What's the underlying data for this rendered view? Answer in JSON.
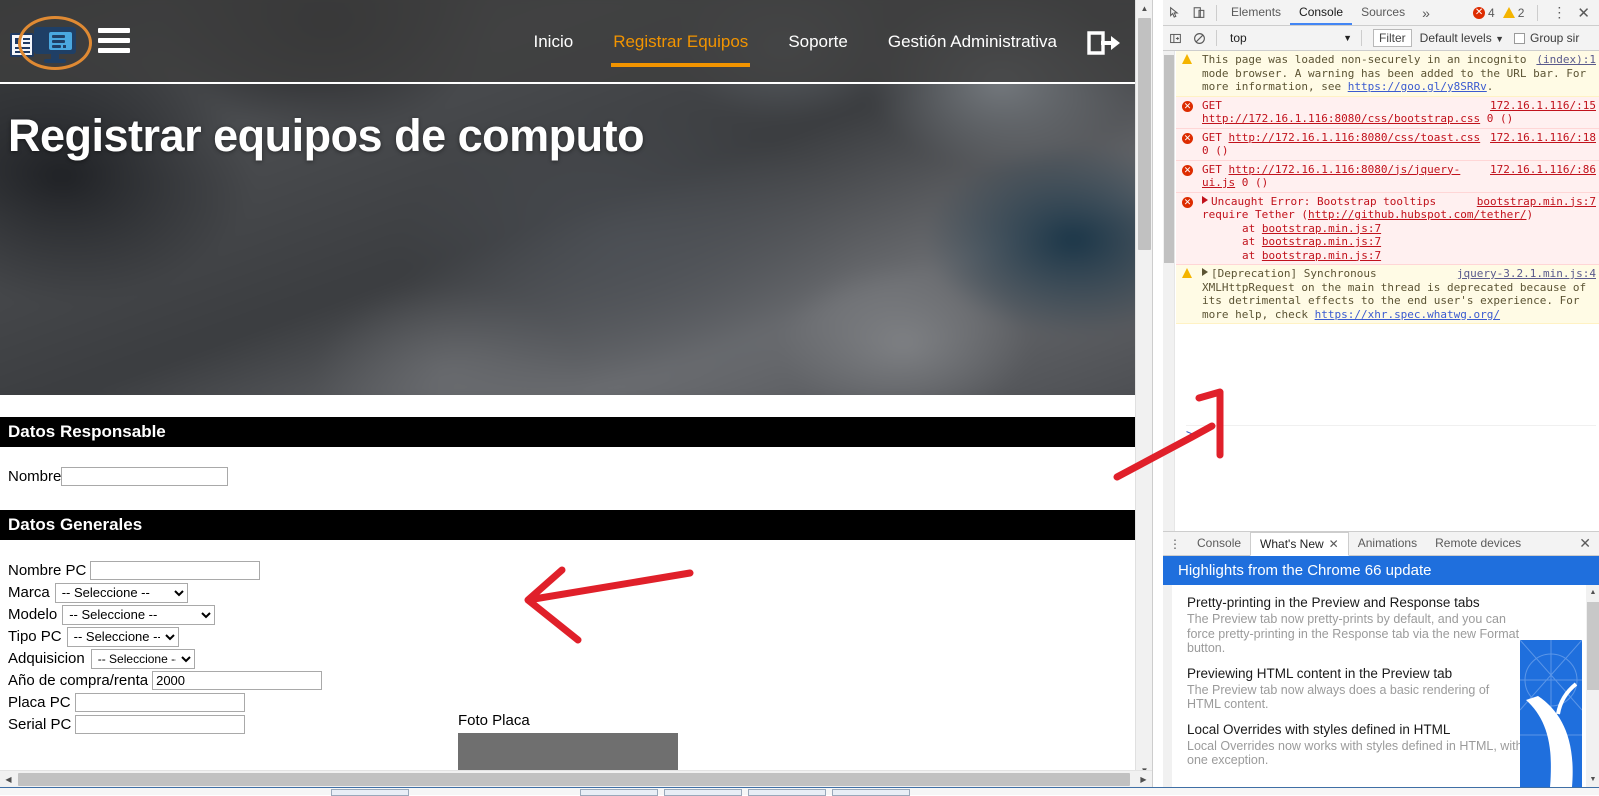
{
  "site": {
    "logo_icon": "monitor-server-logo-icon",
    "menu_icon": "hamburger-menu-icon",
    "logout_icon": "logout-icon",
    "nav": [
      {
        "label": "Inicio",
        "active": false
      },
      {
        "label": "Registrar Equipos",
        "active": true
      },
      {
        "label": "Soporte",
        "active": false
      },
      {
        "label": "Gestión Administrativa",
        "active": false
      }
    ],
    "accent_color": "#f29400",
    "hero_title": "Registrar equipos de computo"
  },
  "form": {
    "section_responsable": "Datos Responsable",
    "section_generales": "Datos Generales",
    "nombre": {
      "label": "Nombre",
      "value": ""
    },
    "nombre_pc": {
      "label": "Nombre PC",
      "value": ""
    },
    "marca": {
      "label": "Marca",
      "value": "-- Seleccione --"
    },
    "modelo": {
      "label": "Modelo",
      "value": "-- Seleccione --"
    },
    "tipo_pc": {
      "label": "Tipo PC",
      "value": "-- Seleccione --"
    },
    "adquisicion": {
      "label": "Adquisicion",
      "value": "-- Seleccione --"
    },
    "anio": {
      "label": "Año de compra/renta",
      "value": "2000"
    },
    "placa_pc": {
      "label": "Placa PC",
      "value": ""
    },
    "serial_pc": {
      "label": "Serial PC",
      "value": ""
    },
    "select_placeholder": "-- Seleccione --",
    "foto_placa_label": "Foto Placa"
  },
  "devtools": {
    "inspect_icon": "inspect-element-icon",
    "device_icon": "device-toolbar-icon",
    "tabs": [
      {
        "label": "Elements",
        "active": false
      },
      {
        "label": "Console",
        "active": true
      },
      {
        "label": "Sources",
        "active": false
      }
    ],
    "more_tabs_icon": "chevron-double-right-icon",
    "error_count": "4",
    "warning_count": "2",
    "kebab_icon": "more-options-kebab-icon",
    "close_icon": "close-icon",
    "sidebar_toggle_icon": "console-sidebar-icon",
    "clear_icon": "clear-console-icon",
    "context": "top",
    "context_caret_icon": "chevron-down-icon",
    "filter_placeholder": "Filter",
    "levels_label": "Default levels",
    "levels_caret_icon": "chevron-down-icon",
    "group_similar_label": "Group sir",
    "prompt_symbol": ">",
    "messages": [
      {
        "level": "warning",
        "source": "(index):1",
        "parts": [
          {
            "t": "This page was loaded non-securely in an incognito mode browser. A warning has been added to the URL bar. For more information, see "
          },
          {
            "t": "https://goo.gl/y8SRRv",
            "link": true
          },
          {
            "t": "."
          }
        ]
      },
      {
        "level": "error",
        "source": "172.16.1.116/:15",
        "parts": [
          {
            "t": "GET "
          },
          {
            "t": "http://172.16.1.116:8080/css/bootstrap.css",
            "link": true
          },
          {
            "t": " 0 ()"
          }
        ]
      },
      {
        "level": "error",
        "source": "172.16.1.116/:18",
        "parts": [
          {
            "t": "GET "
          },
          {
            "t": "http://172.16.1.116:8080/css/toast.css",
            "link": true
          },
          {
            "t": " 0 ()"
          }
        ]
      },
      {
        "level": "error",
        "source": "172.16.1.116/:86",
        "parts": [
          {
            "t": "GET "
          },
          {
            "t": "http://172.16.1.116:8080/js/jquery-ui.js",
            "link": true
          },
          {
            "t": " 0 ()"
          }
        ]
      },
      {
        "level": "error",
        "expandable": true,
        "source": "bootstrap.min.js:7",
        "parts": [
          {
            "t": "Uncaught Error: Bootstrap tooltips require Tether ("
          },
          {
            "t": "http://github.hubspot.com/tether/",
            "link": true
          },
          {
            "t": ")"
          }
        ],
        "stack": [
          {
            "at": "at ",
            "loc": "bootstrap.min.js:7"
          },
          {
            "at": "at ",
            "loc": "bootstrap.min.js:7"
          },
          {
            "at": "at ",
            "loc": "bootstrap.min.js:7"
          }
        ]
      },
      {
        "level": "warning",
        "expandable": true,
        "source": "jquery-3.2.1.min.js:4",
        "parts": [
          {
            "t": "[Deprecation] Synchronous XMLHttpRequest on the main thread is deprecated because of its detrimental effects to the end user's experience. For more help, check "
          },
          {
            "t": "https://xhr.spec.whatwg.org/",
            "link": true
          }
        ]
      }
    ],
    "drawer": {
      "kebab_icon": "more-tools-kebab-icon",
      "tabs": [
        {
          "label": "Console",
          "active": false,
          "closable": false
        },
        {
          "label": "What's New",
          "active": true,
          "closable": true
        },
        {
          "label": "Animations",
          "active": false,
          "closable": false
        },
        {
          "label": "Remote devices",
          "active": false,
          "closable": false
        }
      ],
      "close_icon": "close-icon",
      "banner": "Highlights from the Chrome 66 update",
      "banner_color": "#1f6fdd",
      "items": [
        {
          "heading": "Pretty-printing in the Preview and Response tabs",
          "body": "The Preview tab now pretty-prints by default, and you can force pretty-printing in the Response tab via the new Format button."
        },
        {
          "heading": "Previewing HTML content in the Preview tab",
          "body": "The Preview tab now always does a basic rendering of HTML content."
        },
        {
          "heading": "Local Overrides with styles defined in HTML",
          "body": "Local Overrides now works with styles defined in HTML, with one exception."
        }
      ]
    }
  },
  "annotations": {
    "logo_ellipse_color": "#e08a33",
    "ink_color": "#e0202a",
    "arrow_left_name": "red-arrow-pointing-left",
    "arrow_console_name": "red-arrow-pointing-to-console-prompt"
  },
  "scrollbars": {
    "page_v_up_icon": "scroll-up-arrow-icon",
    "page_v_down_icon": "scroll-down-arrow-icon",
    "page_h_left_icon": "scroll-left-arrow-icon",
    "page_h_right_icon": "scroll-right-arrow-icon"
  }
}
